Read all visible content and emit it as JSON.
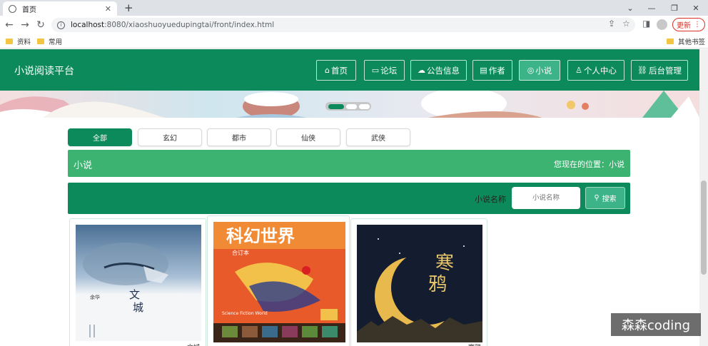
{
  "browser": {
    "tab_title": "首页",
    "url_host": "localhost",
    "url_path": ":8080/xiaoshuoyuedupingtai/front/index.html",
    "update_label": "更新",
    "bookmarks": [
      "资料",
      "常用"
    ],
    "other_bookmarks": "其他书签"
  },
  "site": {
    "logo": "小说阅读平台",
    "nav": [
      {
        "label": "首页",
        "icon": "home-icon",
        "active": false
      },
      {
        "label": "论坛",
        "icon": "forum-icon",
        "active": false
      },
      {
        "label": "公告信息",
        "icon": "cloud-icon",
        "active": false
      },
      {
        "label": "作者",
        "icon": "author-icon",
        "active": false
      },
      {
        "label": "小说",
        "icon": "novel-icon",
        "active": true
      },
      {
        "label": "个人中心",
        "icon": "user-icon",
        "active": false
      },
      {
        "label": "后台管理",
        "icon": "link-icon",
        "active": false
      }
    ]
  },
  "categories": [
    {
      "label": "全部",
      "active": true
    },
    {
      "label": "玄幻",
      "active": false
    },
    {
      "label": "都市",
      "active": false
    },
    {
      "label": "仙侠",
      "active": false
    },
    {
      "label": "武侠",
      "active": false
    }
  ],
  "section": {
    "name": "小说",
    "location": "您现在的位置：小说"
  },
  "search": {
    "label": "小说名称",
    "placeholder": "小说名称",
    "button_label": "搜索"
  },
  "books": [
    {
      "title": "文城",
      "cover_text": "文城",
      "author": "余华"
    },
    {
      "title": "",
      "cover_text": "科幻世界",
      "sub_text": "合订本",
      "extra": "Science Fiction World"
    },
    {
      "title": "寒鸦",
      "cover_text": "寒鸦"
    }
  ],
  "watermark": "森森coding",
  "colors": {
    "primary": "#0d8a5c",
    "accent": "#3db38a",
    "section": "#3db372"
  }
}
